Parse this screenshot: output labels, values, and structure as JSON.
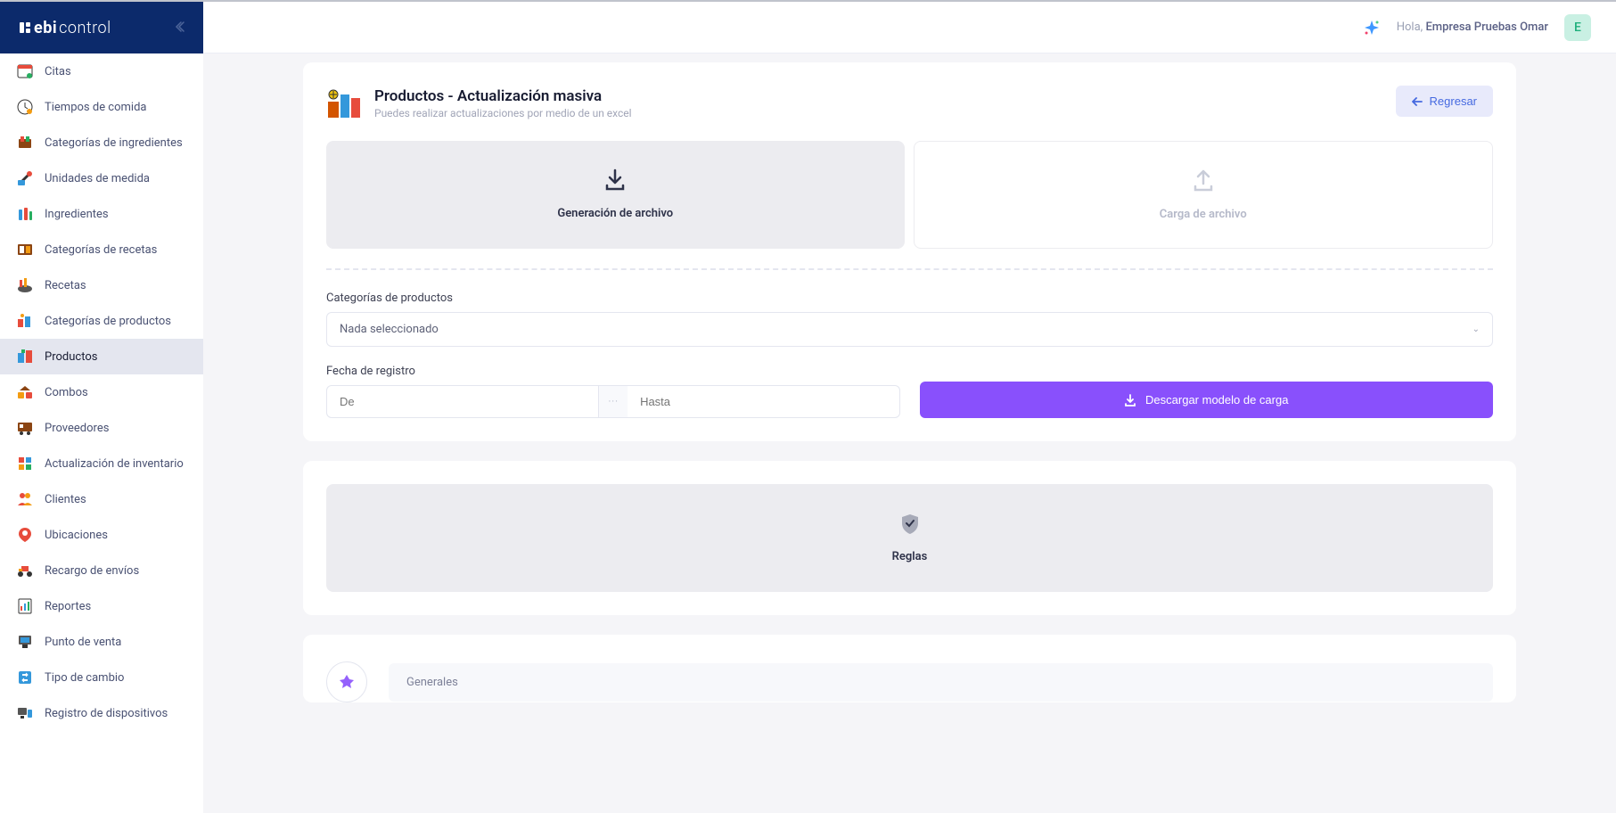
{
  "brand": {
    "bold": "ebi",
    "light": "control"
  },
  "greeting": {
    "hello": "Hola,",
    "name": "Empresa Pruebas Omar",
    "avatar": "E"
  },
  "sidebar": {
    "items": [
      {
        "label": "Citas"
      },
      {
        "label": "Tiempos de comida"
      },
      {
        "label": "Categorías de ingredientes"
      },
      {
        "label": "Unidades de medida"
      },
      {
        "label": "Ingredientes"
      },
      {
        "label": "Categorías de recetas"
      },
      {
        "label": "Recetas"
      },
      {
        "label": "Categorías de productos"
      },
      {
        "label": "Productos"
      },
      {
        "label": "Combos"
      },
      {
        "label": "Proveedores"
      },
      {
        "label": "Actualización de inventario"
      },
      {
        "label": "Clientes"
      },
      {
        "label": "Ubicaciones"
      },
      {
        "label": "Recargo de envíos"
      },
      {
        "label": "Reportes"
      },
      {
        "label": "Punto de venta"
      },
      {
        "label": "Tipo de cambio"
      },
      {
        "label": "Registro de dispositivos"
      }
    ]
  },
  "page": {
    "title": "Productos - Actualización masiva",
    "subtitle": "Puedes realizar actualizaciones por medio de un excel",
    "back_label": "Regresar"
  },
  "tabs": {
    "generate": "Generación de archivo",
    "upload": "Carga de archivo"
  },
  "form": {
    "categories_label": "Categorías de productos",
    "categories_placeholder": "Nada seleccionado",
    "date_label": "Fecha de registro",
    "date_from_placeholder": "De",
    "date_to_placeholder": "Hasta",
    "date_sep": "···",
    "download_label": "Descargar modelo de carga"
  },
  "rules": {
    "label": "Reglas"
  },
  "generals": {
    "label": "Generales"
  }
}
